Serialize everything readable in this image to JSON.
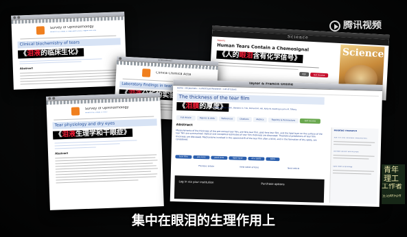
{
  "watermark": {
    "logo_text": "腾讯视频"
  },
  "caption": "集中在眼泪的生理作用上",
  "corner_badge": {
    "lines": [
      "青年",
      "理工",
      "工作者"
    ],
    "small": "生活研究所"
  },
  "win1": {
    "journal": "Survey of Ophthalmology",
    "journal_sub": "Volume 55, Issue 3, May–June 2010, Pages 229–240",
    "article_title": "Clinical biochemistry of tears",
    "subtitle_pre": "《",
    "subtitle_hl": "泪液",
    "subtitle_post": "的临床生化》",
    "section": "Abstract"
  },
  "win2": {
    "brand": "ScienceDirect",
    "journal": "Clinica Chimica Acta",
    "article_title": "Laboratory findings in tear fluid",
    "subtitle_pre": "《",
    "subtitle_hl": "泪液",
    "subtitle_post": "分析的实验室"
  },
  "win3": {
    "journal": "Survey of Ophthalmology",
    "journal_sub": "Volume 62, Issue 3, 2017",
    "article_title": "Tear physiology and dry eyes",
    "subtitle_pre": "《",
    "subtitle_hl": "泪液",
    "subtitle_post": "生理学和干眼症》",
    "section": "Abstract"
  },
  "win4": {
    "brand": "Science",
    "section": "Reports",
    "article_title": "Human Tears Contain a Chemosignal",
    "subtitle_pre": "《人的",
    "subtitle_hl": "眼泪",
    "subtitle_post": "含有化学信号》",
    "cover_title": "Science",
    "pdf_button": "PDF",
    "buy_button": "Get Access"
  },
  "win5": {
    "brand": "Taylor & Francis Online",
    "breadcrumb": "Home › All Journals › Current Eye Research › List of Issues",
    "article_title": "The thickness of the tear film",
    "subtitle_pre": "《",
    "subtitle_hl": "泪膜",
    "subtitle_post": "的厚度》",
    "authors": "P. Ewen King-Smith, Barbara A. Fink, Richard M. Hill, Kelly W. Koelling & John M. Tiffany",
    "tabs": [
      "Full Article",
      "Figures & data",
      "References",
      "Citations",
      "Metrics",
      "Reprints & Permissions",
      "Get access"
    ],
    "abstract_heading": "Abstract",
    "abstract_text": "Measurements of the thickness of the pre-corneal tear film, pre-lens tear film, post-lens tear film, and the lipid layer on the surface of the tear film are summarized. Optical and nonoptical estimates of tear film thickness are discussed. Theoretical predictions of tear film thickness are discussed. Mechanisms involved in the upward drift of the tear film after a blink, and in the formation of dry spots, are considered.",
    "keywords": [
      "tear film",
      "pre-lens",
      "post-lens",
      "lipid layer",
      "dry spots",
      "blink"
    ],
    "prev_link": "Previous article",
    "view_issue": "View latest articles",
    "next_link": "Next article",
    "login_text": "Log in via your institution",
    "purchase_text": "Purchase options",
    "sidebar_heading": "Related research",
    "sidebar_items": [
      "Tear film and thickness measurement",
      "Corneal surface and dry eye",
      "Lipid layer physiology"
    ]
  }
}
